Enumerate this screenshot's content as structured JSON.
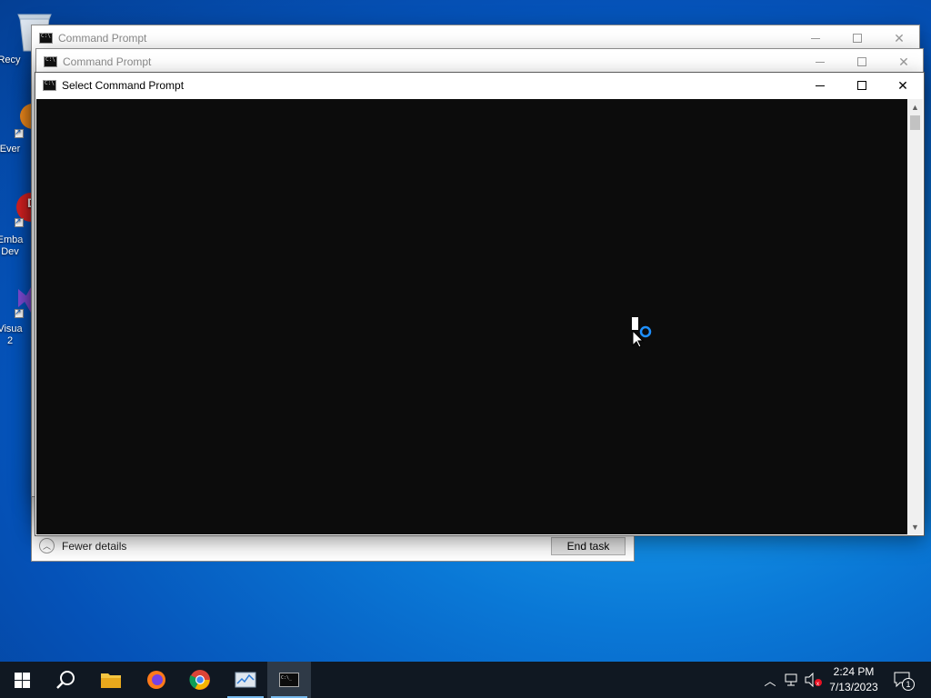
{
  "desktop": {
    "icons": [
      {
        "label": "Recy",
        "icon": "recycle-bin-icon"
      },
      {
        "label": "Ever",
        "icon": "everything-app-icon"
      },
      {
        "label": "Emba\nDev",
        "icon": "embarcadero-dev-icon"
      },
      {
        "label": "Visua\n2",
        "icon": "visual-studio-icon"
      }
    ]
  },
  "windows": {
    "back": {
      "title": "Command Prompt"
    },
    "middle": {
      "title": "Command Prompt"
    },
    "front": {
      "title": "Select Command Prompt"
    },
    "task_manager": {
      "fewer_details": "Fewer details",
      "end_task": "End task"
    }
  },
  "taskbar": {
    "buttons": [
      "start-icon",
      "search-icon",
      "file-explorer-icon",
      "firefox-icon",
      "chrome-icon",
      "task-manager-icon",
      "command-prompt-icon"
    ],
    "active": "command-prompt-icon",
    "time": "2:24 PM",
    "date": "7/13/2023",
    "notification_count": "1"
  },
  "colors": {
    "console_bg": "#0c0c0c",
    "taskbar_bg": "#101822",
    "accent": "#76b9ed"
  }
}
